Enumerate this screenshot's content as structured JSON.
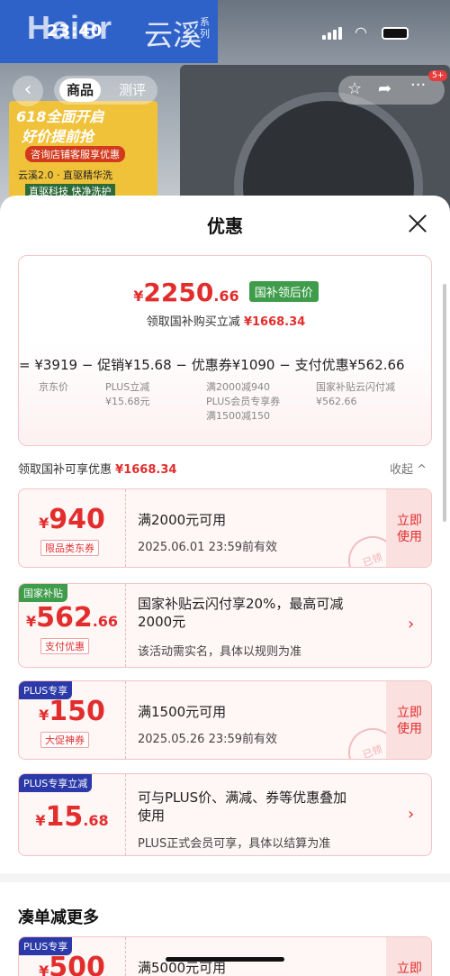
{
  "status": {
    "time": "23:40"
  },
  "banner": {
    "brand_logo": "Haier",
    "series": "云溪",
    "series_suffix": "系列",
    "promo_line1": "618全面开启",
    "promo_line2": "好价提前抢",
    "promo_line3": "咨询店铺客服享优惠",
    "promo_line4": "云溪2.0 · 直驱精华洗",
    "promo_line5": "直驱科技 快净洗护",
    "badge": "618"
  },
  "nav": {
    "tab_goods": "商品",
    "tab_review": "测评",
    "cart_count": "5+"
  },
  "sheet": {
    "title": "优惠",
    "summary": {
      "price_int": "2250",
      "price_dec": ".66",
      "price_tag": "国补领后价",
      "sub_text": "领取国补购买立减",
      "sub_amount": "¥1668.34",
      "calc_line": "= ¥3919 − 促销¥15.68 − 优惠券¥1090 − 支付优惠¥562.66",
      "items": [
        {
          "label": "京东价"
        },
        {
          "label": "PLUS立减\n¥15.68元"
        },
        {
          "label": "满2000减940\nPLUS会员专享券\n满1500减150"
        },
        {
          "label": "国家补贴云闪付减\n¥562.66"
        }
      ]
    },
    "section_label": "领取国补可享优惠",
    "section_amount": "¥1668.34",
    "collapse_label": "收起 ^",
    "cards": [
      {
        "badge": "",
        "amount_int": "940",
        "amount_dec": "",
        "tag": "限品类东券",
        "cond": "满2000元可用",
        "valid": "2025.06.01 23:59前有效",
        "action": "立即\n使用"
      },
      {
        "badge": "国家补贴",
        "amount_int": "562",
        "amount_dec": ".66",
        "tag": "支付优惠",
        "cond": "国家补贴云闪付享20%，最高可减\n2000元",
        "valid": "该活动需实名，具体以规则为准",
        "action": "›"
      },
      {
        "badge": "PLUS专享",
        "amount_int": "150",
        "amount_dec": "",
        "tag": "大促神券",
        "cond": "满1500元可用",
        "valid": "2025.05.26 23:59前有效",
        "action": "立即\n使用"
      },
      {
        "badge": "PLUS专享立减",
        "amount_int": "15",
        "amount_dec": ".68",
        "tag": "",
        "cond": "可与PLUS价、满减、券等优惠叠加\n使用",
        "valid": "PLUS正式会员可享，具体以结算为准",
        "action": "›"
      },
      {
        "badge": "PLUS专享",
        "amount_int": "500",
        "amount_dec": "",
        "tag": "",
        "cond": "满5000元可用",
        "valid": "",
        "action": "立即"
      }
    ],
    "stamp": "已领",
    "more_title": "凑单减更多"
  },
  "colors": {
    "accent": "#e22d2d",
    "green": "#3e9c4b",
    "plus": "#2b3aa8"
  }
}
